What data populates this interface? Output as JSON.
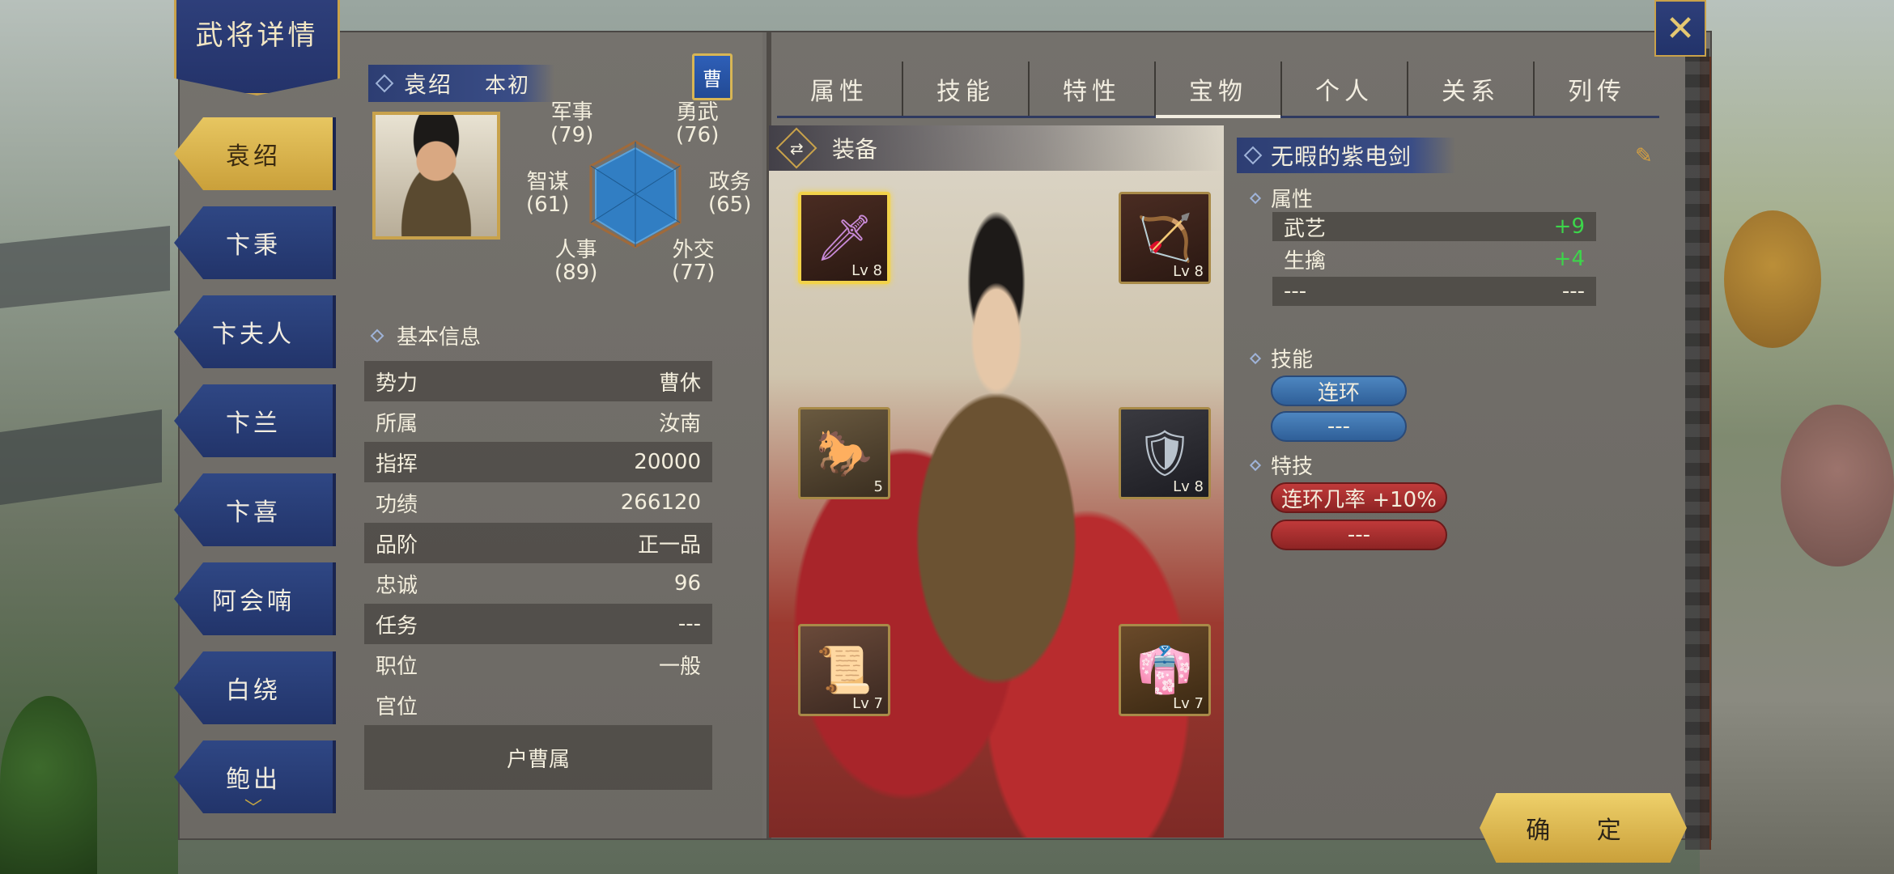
{
  "title": "武将详情",
  "nav": {
    "items": [
      {
        "label": "袁绍",
        "active": true
      },
      {
        "label": "卞秉",
        "active": false
      },
      {
        "label": "卞夫人",
        "active": false
      },
      {
        "label": "卞兰",
        "active": false
      },
      {
        "label": "卞喜",
        "active": false
      },
      {
        "label": "阿会喃",
        "active": false
      },
      {
        "label": "白绕",
        "active": false
      },
      {
        "label": "鲍出",
        "active": false
      }
    ]
  },
  "general": {
    "name": "袁绍",
    "courtesy": "本初",
    "faction_flag": "曹"
  },
  "stats": {
    "military": {
      "label": "军事",
      "value": "(79)"
    },
    "valor": {
      "label": "勇武",
      "value": "(76)"
    },
    "intellect": {
      "label": "智谋",
      "value": "(61)"
    },
    "politics": {
      "label": "政务",
      "value": "(65)"
    },
    "personnel": {
      "label": "人事",
      "value": "(89)"
    },
    "diplomacy": {
      "label": "外交",
      "value": "(77)"
    }
  },
  "basic_info": {
    "heading": "基本信息",
    "rows": [
      {
        "label": "势力",
        "value": "曹休"
      },
      {
        "label": "所属",
        "value": "汝南"
      },
      {
        "label": "指挥",
        "value": "20000"
      },
      {
        "label": "功绩",
        "value": "266120"
      },
      {
        "label": "品阶",
        "value": "正一品"
      },
      {
        "label": "忠诚",
        "value": "96"
      },
      {
        "label": "任务",
        "value": "---"
      },
      {
        "label": "职位",
        "value": "一般"
      },
      {
        "label": "官位",
        "value": ""
      }
    ],
    "official_title": "户曹属"
  },
  "tabs": [
    "属性",
    "技能",
    "特性",
    "宝物",
    "个人",
    "关系",
    "列传"
  ],
  "active_tab": "宝物",
  "equipment": {
    "heading": "装备",
    "slots": [
      {
        "name": "sword",
        "level": "Lv 8",
        "selected": true
      },
      {
        "name": "bow",
        "level": "Lv 8",
        "selected": false
      },
      {
        "name": "horse",
        "level": "5",
        "selected": false
      },
      {
        "name": "armor",
        "level": "Lv 8",
        "selected": false
      },
      {
        "name": "book",
        "level": "Lv 7",
        "selected": false
      },
      {
        "name": "robe",
        "level": "Lv 7",
        "selected": false
      }
    ]
  },
  "treasure": {
    "name": "无暇的紫电剑",
    "attr_heading": "属性",
    "attrs": [
      {
        "label": "武艺",
        "value": "+9"
      },
      {
        "label": "生擒",
        "value": "+4"
      },
      {
        "label": "---",
        "value": "---"
      }
    ],
    "skill_heading": "技能",
    "skills": [
      "连环",
      "---"
    ],
    "trait_heading": "特技",
    "traits": [
      "连环几率 +10%",
      "---"
    ]
  },
  "confirm_label": "确 定",
  "colors": {
    "panel": "#6f6c68",
    "nav_blue": "#2f4784",
    "gold": "#caa03a",
    "positive": "#3cd64a",
    "skill_blue": "#4d86c0",
    "trait_red": "#c03a3a"
  }
}
